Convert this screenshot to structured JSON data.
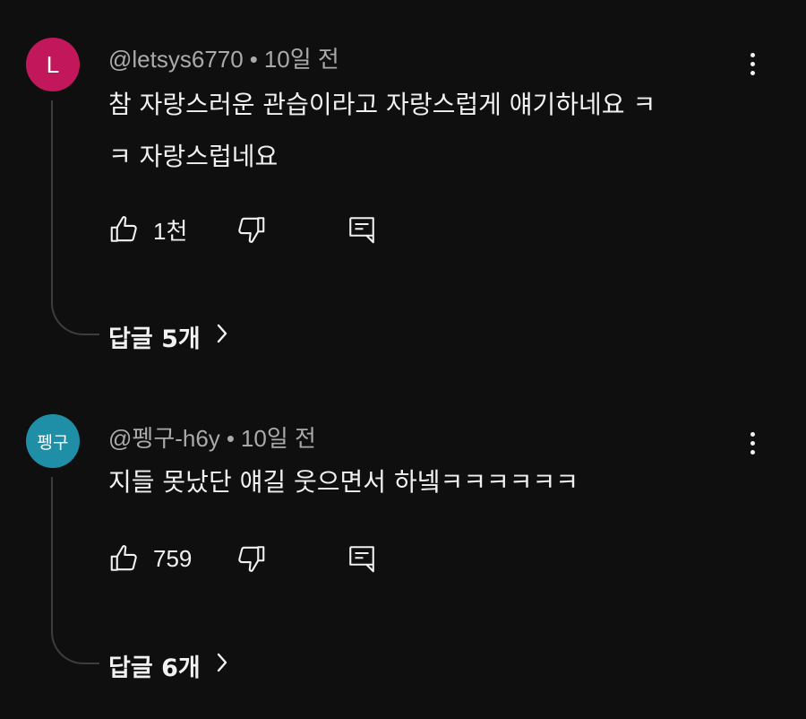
{
  "comments": [
    {
      "avatar_text": "L",
      "avatar_color": "#c2185b",
      "handle": "@letsys6770",
      "time": "10일 전",
      "text": "참 자랑스러운 관습이라고 자랑스럽게 얘기하네요 ㅋ\nㅋ 자랑스럽네요",
      "like_count": "1천",
      "replies_label": "답글 5개"
    },
    {
      "avatar_text": "펭구",
      "avatar_color": "#1e8fa6",
      "handle": "@펭구-h6y",
      "time": "10일 전",
      "text": "지들 못났단 얘길 웃으면서 하넼ㅋㅋㅋㅋㅋㅋ",
      "like_count": "759",
      "replies_label": "답글 6개"
    }
  ],
  "separator": "•",
  "icons": {
    "like": "thumbs-up-icon",
    "dislike": "thumbs-down-icon",
    "reply": "reply-comment-icon",
    "more": "more-vert-icon",
    "chevron": "chevron-right-icon"
  },
  "colors": {
    "background": "#0f0f0f",
    "text_primary": "#f1f1f1",
    "text_secondary": "#aaaaaa",
    "thread_line": "#3d3d3d"
  }
}
